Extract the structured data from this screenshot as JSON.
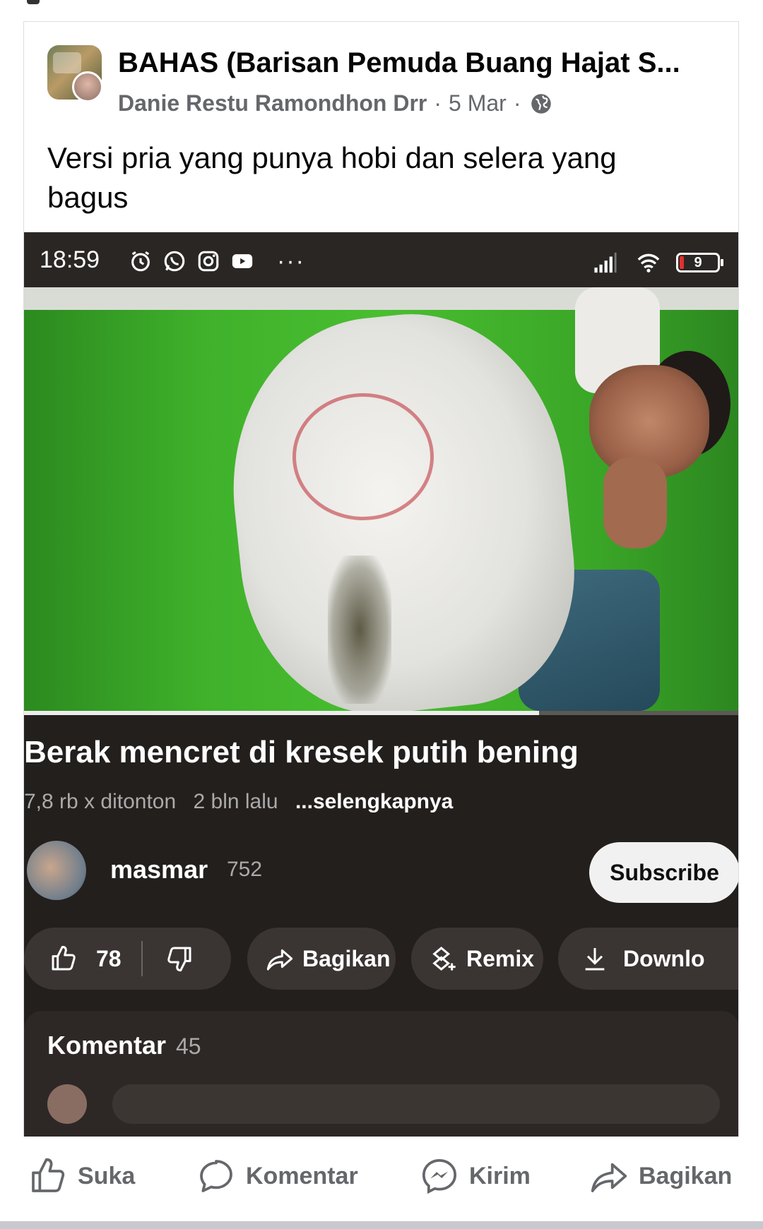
{
  "post": {
    "group_name": "BAHAS (Barisan Pemuda Buang Hajat S...",
    "author": "Danie Restu Ramondhon Drr",
    "date": "5 Mar",
    "separator": "·",
    "caption": "Versi pria yang punya hobi dan selera yang bagus"
  },
  "embedded": {
    "status_time": "18:59",
    "battery": "9",
    "video_title": "Berak mencret di kresek putih bening",
    "views": "7,8 rb x ditonton",
    "age": "2 bln lalu",
    "more": "...selengkapnya",
    "progress_fraction": 0.72,
    "channel": {
      "name": "masmar",
      "subs": "752",
      "subscribe_label": "Subscribe"
    },
    "actions": {
      "like_count": "78",
      "share_label": "Bagikan",
      "remix_label": "Remix",
      "download_label": "Downlo"
    },
    "comments": {
      "label": "Komentar",
      "count": "45"
    }
  },
  "post_actions": {
    "like": "Suka",
    "comment": "Komentar",
    "send": "Kirim",
    "share": "Bagikan"
  },
  "colors": {
    "facebook_gray": "#65676b",
    "youtube_dark": "#231f1d",
    "pill": "#3a3533"
  }
}
